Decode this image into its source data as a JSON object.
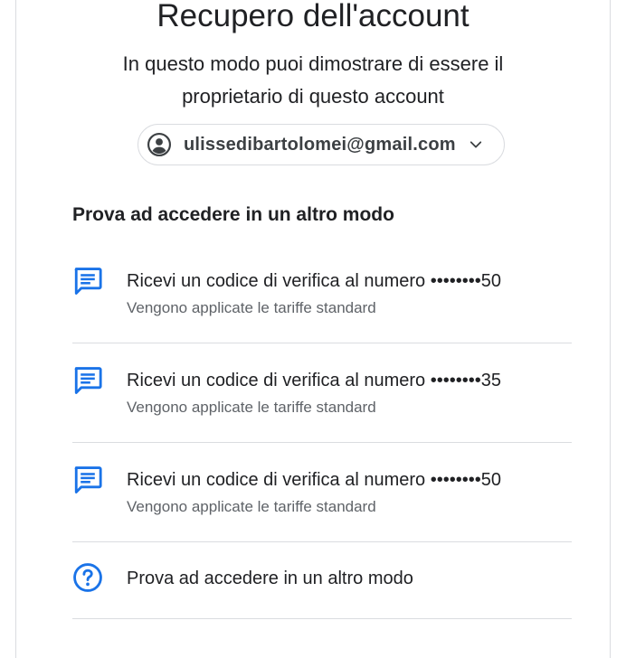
{
  "page": {
    "title": "Recupero dell'account",
    "subtitle": "In questo modo puoi dimostrare di essere il proprietario di questo account"
  },
  "account": {
    "email": "ulissedibartolomei@gmail.com",
    "avatar_icon": "account-circle-icon",
    "dropdown_icon": "chevron-down-icon"
  },
  "section": {
    "heading": "Prova ad accedere in un altro modo"
  },
  "options": [
    {
      "icon": "message-icon",
      "title": "Ricevi un codice di verifica al numero ••••••••50",
      "subtitle": "Vengono applicate le tariffe standard"
    },
    {
      "icon": "message-icon",
      "title": "Ricevi un codice di verifica al numero ••••••••35",
      "subtitle": "Vengono applicate le tariffe standard"
    },
    {
      "icon": "message-icon",
      "title": "Ricevi un codice di verifica al numero ••••••••50",
      "subtitle": "Vengono applicate le tariffe standard"
    },
    {
      "icon": "help-circle-icon",
      "title": "Prova ad accedere in un altro modo"
    }
  ],
  "colors": {
    "accent": "#1a73e8",
    "border": "#dadce0",
    "text_primary": "#202124",
    "text_secondary": "#5f6368"
  }
}
